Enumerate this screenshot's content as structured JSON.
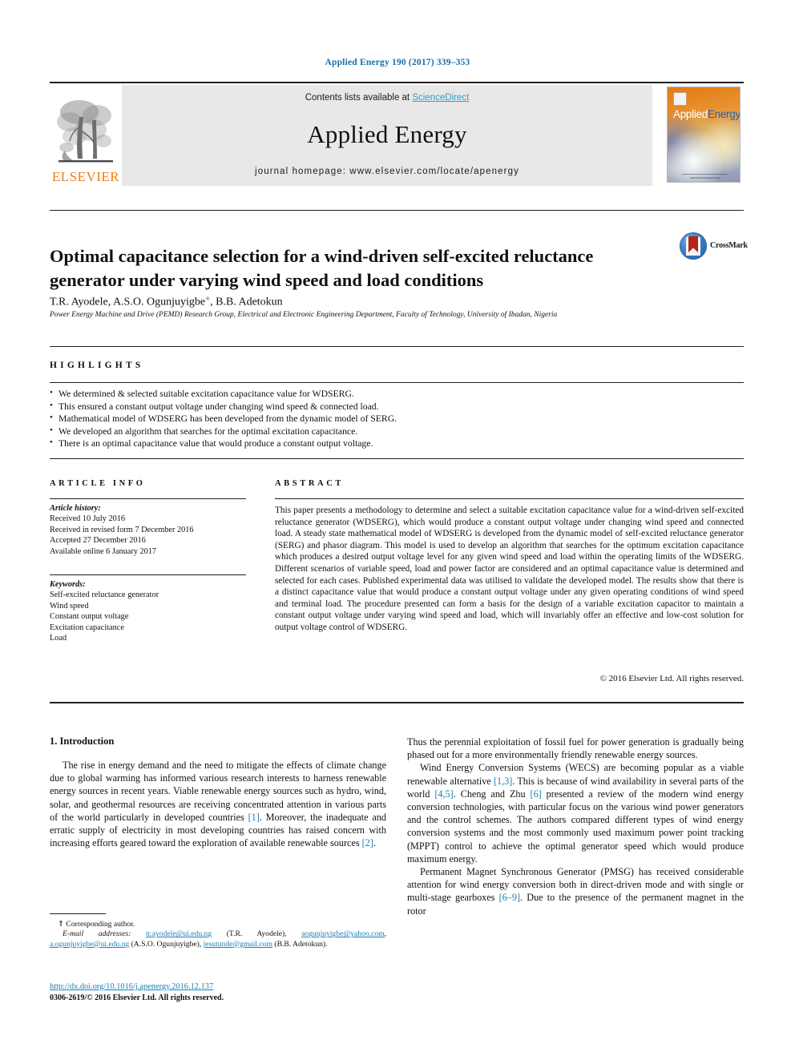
{
  "running_head": "Applied Energy 190 (2017) 339–353",
  "masthead": {
    "elsevier_wordmark": "ELSEVIER",
    "contents_prefix": "Contents lists available at ",
    "contents_link": "ScienceDirect",
    "journal_title": "Applied Energy",
    "homepage_line": "journal homepage: www.elsevier.com/locate/apenergy",
    "cover": {
      "word1": "Applied",
      "word2": "Energy"
    }
  },
  "article": {
    "title": "Optimal capacitance selection for a wind-driven self-excited reluctance generator under varying wind speed and load conditions",
    "authors_pre": "T.R. Ayodele, A.S.O. Ogunjuyigbe",
    "authors_post": ", B.B. Adetokun",
    "affiliation": "Power Energy Machine and Drive (PEMD) Research Group, Electrical and Electronic Engineering Department, Faculty of Technology, University of Ibadan, Nigeria",
    "crossmark_label": "CrossMark"
  },
  "highlights": {
    "heading": "HIGHLIGHTS",
    "items": [
      "We determined & selected suitable excitation capacitance value for WDSERG.",
      "This ensured a constant output voltage under changing wind speed & connected load.",
      "Mathematical model of WDSERG has been developed from the dynamic model of SERG.",
      "We developed an algorithm that searches for the optimal excitation capacitance.",
      "There is an optimal capacitance value that would produce a constant output voltage."
    ]
  },
  "article_info": {
    "heading": "ARTICLE INFO",
    "history_label": "Article history:",
    "history": [
      "Received 10 July 2016",
      "Received in revised form 7 December 2016",
      "Accepted 27 December 2016",
      "Available online 6 January 2017"
    ],
    "keywords_label": "Keywords:",
    "keywords": [
      "Self-excited reluctance generator",
      "Wind speed",
      "Constant output voltage",
      "Excitation capacitance",
      "Load"
    ]
  },
  "abstract": {
    "heading": "ABSTRACT",
    "text": "This paper presents a methodology to determine and select a suitable excitation capacitance value for a wind-driven self-excited reluctance generator (WDSERG), which would produce a constant output voltage under changing wind speed and connected load. A steady state mathematical model of WDSERG is developed from the dynamic model of self-excited reluctance generator (SERG) and phasor diagram. This model is used to develop an algorithm that searches for the optimum excitation capacitance which produces a desired output voltage level for any given wind speed and load within the operating limits of the WDSERG. Different scenarios of variable speed, load and power factor are considered and an optimal capacitance value is determined and selected for each cases. Published experimental data was utilised to validate the developed model. The results show that there is a distinct capacitance value that would produce a constant output voltage under any given operating conditions of wind speed and terminal load. The procedure presented can form a basis for the design of a variable excitation capacitor to maintain a constant output voltage under varying wind speed and load, which will invariably offer an effective and low-cost solution for output voltage control of WDSERG.",
    "copyright": "© 2016 Elsevier Ltd. All rights reserved."
  },
  "body": {
    "section_heading": "1. Introduction",
    "left_par1_a": "The rise in energy demand and the need to mitigate the effects of climate change due to global warming has informed various research interests to harness renewable energy sources in recent years. Viable renewable energy sources such as hydro, wind, solar, and geothermal resources are receiving concentrated attention in various parts of the world particularly in developed countries ",
    "left_par1_ref1": "[1]",
    "left_par1_b": ". Moreover, the inadequate and erratic supply of electricity in most developing countries has raised concern with increasing efforts geared toward the exploration of available renewable sources ",
    "left_par1_ref2": "[2]",
    "left_par1_c": ".",
    "right_par1": "Thus the perennial exploitation of fossil fuel for power generation is gradually being phased out for a more environmentally friendly renewable energy sources.",
    "right_par2_a": "Wind Energy Conversion Systems (WECS) are becoming popular as a viable renewable alternative ",
    "right_par2_ref1": "[1,3]",
    "right_par2_b": ". This is because of wind availability in several parts of the world ",
    "right_par2_ref2": "[4,5]",
    "right_par2_c": ". Cheng and Zhu ",
    "right_par2_ref3": "[6]",
    "right_par2_d": " presented a review of the modern wind energy conversion technologies, with particular focus on the various wind power generators and the control schemes. The authors compared different types of wind energy conversion systems and the most commonly used maximum power point tracking (MPPT) control to achieve the optimal generator speed which would produce maximum energy.",
    "right_par3_a": "Permanent Magnet Synchronous Generator (PMSG) has received considerable attention for wind energy conversion both in direct-driven mode and with single or multi-stage gearboxes ",
    "right_par3_ref1": "[6–9]",
    "right_par3_b": ". Due to the presence of the permanent magnet in the rotor"
  },
  "footnote": {
    "corresponding": "⇑ Corresponding author.",
    "emails_label": "E-mail addresses:",
    "email1": "tr.ayodele@ui.edu.ng",
    "name1": " (T.R. Ayodele), ",
    "email2": "aogunjuyigbe@yahoo.com",
    "sep2": ", ",
    "email3": "a.ogunjuyigbe@ui.edu.ng",
    "name3": " (A.S.O. Ogunjuyigbe), ",
    "email4": "jesutunde@gmail.com",
    "name4": " (B.B. Adetokun)."
  },
  "footer": {
    "doi": "http://dx.doi.org/10.1016/j.apenergy.2016.12.137",
    "issn": "0306-2619/© 2016 Elsevier Ltd. All rights reserved."
  },
  "colors": {
    "link": "#1a7fb5",
    "journal_head": "#1a6ea8",
    "elsevier_orange": "#ef7d1a",
    "sciencedirect": "#2e9dd4"
  }
}
